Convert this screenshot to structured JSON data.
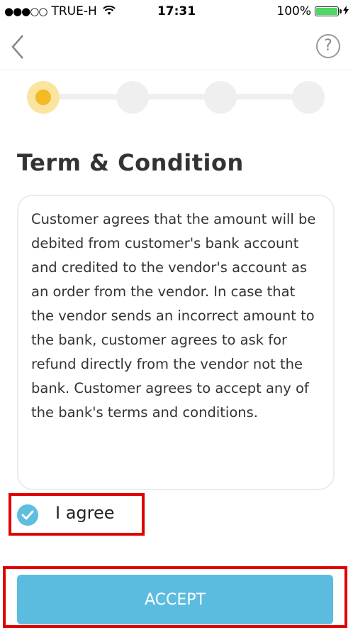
{
  "status_bar": {
    "signal": "●●●○○",
    "carrier": "TRUE-H",
    "time": "17:31",
    "battery": "100%"
  },
  "nav": {
    "help_symbol": "?"
  },
  "stepper": {
    "total_steps": 4,
    "current_step": 1
  },
  "page": {
    "title": "Term & Condition",
    "terms_text": "Customer agrees that the amount will be debited from customer's bank account and credited to the vendor's account as an order from the vendor. In case that the vendor sends an incorrect amount to the bank, customer agrees to ask for refund directly from the vendor not the bank. Customer agrees to accept any of the bank's terms and conditions."
  },
  "agreement": {
    "label": "I agree",
    "checked": true
  },
  "actions": {
    "accept_label": "ACCEPT"
  },
  "colors": {
    "accent": "#5bbcdf",
    "step_active": "#f5b924",
    "highlight": "#e00000"
  }
}
